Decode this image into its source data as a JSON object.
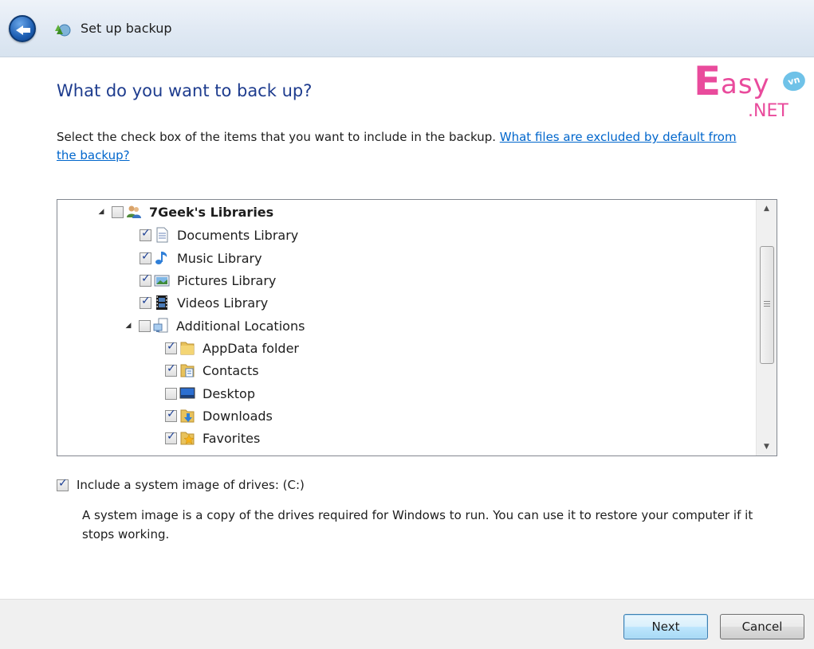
{
  "window": {
    "title": "Set up backup"
  },
  "logo": {
    "text": "Easy",
    "badge": "vn",
    "suffix": ".NET"
  },
  "page": {
    "heading": "What do you want to back up?",
    "instruction": "Select the check box of the items that you want to include in the backup. ",
    "link": "What files are excluded by default from the backup?"
  },
  "tree": {
    "items": [
      {
        "label": "7Geek's Libraries",
        "checked": false,
        "icon": "users-library-icon"
      },
      {
        "label": "Documents Library",
        "checked": true,
        "icon": "documents-icon"
      },
      {
        "label": "Music Library",
        "checked": true,
        "icon": "music-icon"
      },
      {
        "label": "Pictures Library",
        "checked": true,
        "icon": "pictures-icon"
      },
      {
        "label": "Videos Library",
        "checked": true,
        "icon": "videos-icon"
      },
      {
        "label": "Additional Locations",
        "checked": false,
        "icon": "computer-locations-icon"
      },
      {
        "label": "AppData folder",
        "checked": true,
        "icon": "folder-icon"
      },
      {
        "label": "Contacts",
        "checked": true,
        "icon": "contacts-folder-icon"
      },
      {
        "label": "Desktop",
        "checked": false,
        "icon": "desktop-icon"
      },
      {
        "label": "Downloads",
        "checked": true,
        "icon": "downloads-folder-icon"
      },
      {
        "label": "Favorites",
        "checked": true,
        "icon": "favorites-folder-icon"
      }
    ]
  },
  "system_image": {
    "checked": true,
    "label": "Include a system image of drives: (C:)",
    "description": "A system image is a copy of the drives required for Windows to run. You can use it to restore your computer if it stops working."
  },
  "buttons": {
    "next": "Next",
    "cancel": "Cancel"
  }
}
